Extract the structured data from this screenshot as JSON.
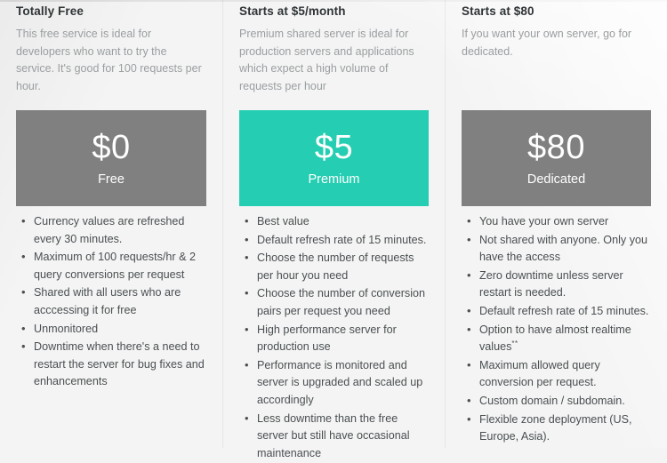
{
  "columns": [
    {
      "title": "Totally Free",
      "description": "This free service is ideal for developers who want to try the service. It's good for 100 requests per hour.",
      "price_amount": "$0",
      "price_label": "Free",
      "box_color": "#808080",
      "features": [
        "Currency values are refreshed every 30 minutes.",
        "Maximum of 100 requests/hr & 2 query conversions per request",
        "Shared with all users who are acccessing it for free",
        "Unmonitored",
        "Downtime when there's a need to restart the server for bug fixes and enhancements"
      ]
    },
    {
      "title": "Starts at $5/month",
      "description": "Premium shared server is ideal for production servers and applications which expect a high volume of requests per hour",
      "price_amount": "$5",
      "price_label": "Premium",
      "box_color": "#25ceb2",
      "features": [
        "Best value",
        "Default refresh rate of 15 minutes.",
        "Choose the number of requests per hour you need",
        "Choose the number of conversion pairs per request you need",
        "High performance server for production use",
        "Performance is monitored and server is upgraded and scaled up accordingly",
        "Less downtime than the free server but still have occasional maintenance"
      ]
    },
    {
      "title": "Starts at $80",
      "description": "If you want your own server, go for dedicated.",
      "price_amount": "$80",
      "price_label": "Dedicated",
      "box_color": "#808080",
      "features": [
        "You have your own server",
        "Not shared with anyone. Only you have the access",
        "Zero downtime unless server restart is needed.",
        "Default refresh rate of 15 minutes.",
        "Option to have almost realtime values",
        "Maximum allowed query conversion per request.",
        "Custom domain / subdomain.",
        "Flexible zone deployment (US, Europe, Asia)."
      ],
      "feature_superscripts": {
        "4": "**"
      }
    }
  ],
  "theme": {
    "background": "#f4f4f4",
    "accent_color": "#25ceb2",
    "neutral_box_color": "#808080",
    "title_color": "#2f3436",
    "description_color": "#9a9ea1",
    "feature_color": "#4a4f52"
  }
}
